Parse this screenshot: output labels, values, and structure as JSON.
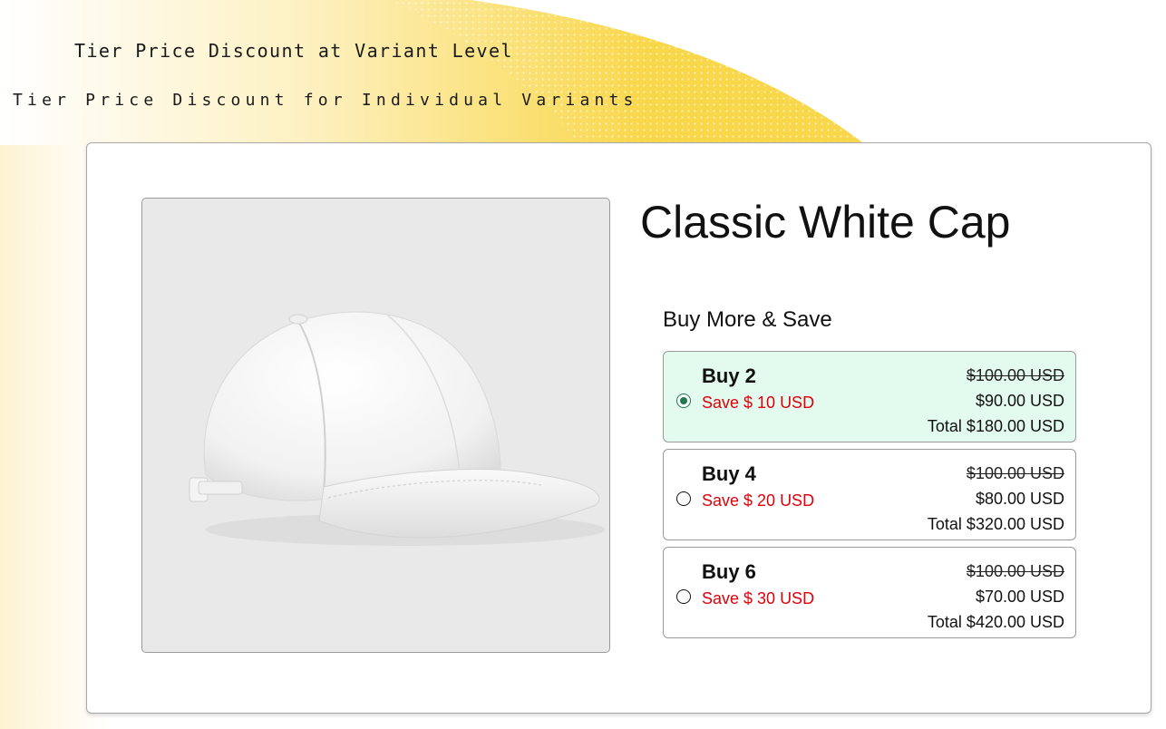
{
  "headlines": {
    "primary": "Tier Price Discount at Variant Level",
    "secondary": "Tier Price Discount for Individual Variants"
  },
  "colors": {
    "banner_yellow": "#f9d74a",
    "selected_tier_bg": "#e3faef",
    "save_text": "#e0000a",
    "radio_checked": "#1f7a4d"
  },
  "product": {
    "title": "Classic White Cap",
    "image_icon": "white-baseball-cap"
  },
  "offer": {
    "label": "Buy More & Save",
    "tiers": [
      {
        "name": "Buy 2",
        "save": "Save $ 10 USD",
        "original_price": "$100.00 USD",
        "price": "$90.00 USD",
        "total": "Total $180.00 USD",
        "selected": true
      },
      {
        "name": "Buy 4",
        "save": "Save $ 20 USD",
        "original_price": "$100.00 USD",
        "price": "$80.00 USD",
        "total": "Total $320.00 USD",
        "selected": false
      },
      {
        "name": "Buy 6",
        "save": "Save $ 30 USD",
        "original_price": "$100.00 USD",
        "price": "$70.00 USD",
        "total": "Total $420.00 USD",
        "selected": false
      }
    ]
  }
}
